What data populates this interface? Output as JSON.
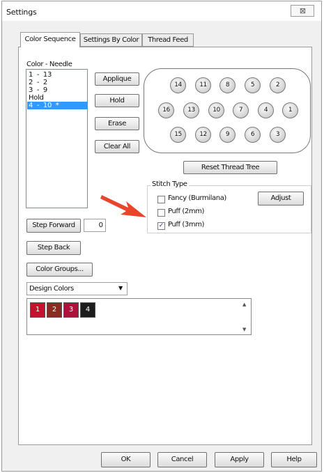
{
  "window": {
    "title": "Settings",
    "close_glyph": "⊠"
  },
  "tabs": [
    {
      "label": "Color Sequence",
      "active": true
    },
    {
      "label": "Settings By Color",
      "active": false
    },
    {
      "label": "Thread Feed",
      "active": false
    }
  ],
  "color_sequence": {
    "list_label": "Color - Needle",
    "list_items": [
      {
        "text": "1  -  13",
        "selected": false
      },
      {
        "text": "2  -  2",
        "selected": false
      },
      {
        "text": "3  -  9",
        "selected": false
      },
      {
        "text": "Hold",
        "selected": false
      },
      {
        "text": "4  -  10  *",
        "selected": true
      }
    ],
    "buttons": {
      "applique": "Applique",
      "hold": "Hold",
      "erase": "Erase",
      "clear_all": "Clear All"
    },
    "needles_row1": [
      "14",
      "11",
      "8",
      "5",
      "2"
    ],
    "needles_row2": [
      "16",
      "13",
      "10",
      "7",
      "4",
      "1"
    ],
    "needles_row3": [
      "15",
      "12",
      "9",
      "6",
      "3"
    ],
    "reset_thread_tree": "Reset Thread Tree",
    "stitch_type": {
      "title": "Stitch  Type",
      "options": [
        {
          "label": "Fancy (Burmilana)",
          "checked": false
        },
        {
          "label": "Puff (2mm)",
          "checked": false
        },
        {
          "label": "Puff (3mm)",
          "checked": true
        }
      ],
      "adjust": "Adjust",
      "check_glyph": "✓"
    },
    "step_forward": "Step Forward",
    "step_value": "0",
    "step_back": "Step Back",
    "color_groups": "Color Groups...",
    "dropdown": {
      "selected": "Design Colors",
      "arrow_glyph": "▼"
    },
    "swatches": [
      {
        "label": "1",
        "color": "#c8102e"
      },
      {
        "label": "2",
        "color": "#8b2a1e"
      },
      {
        "label": "3",
        "color": "#b0103a"
      },
      {
        "label": "4",
        "color": "#1c1c1c"
      }
    ],
    "scroll_up_glyph": "▲",
    "scroll_down_glyph": "▼",
    "arrow_color": "#e8452c"
  },
  "footer": {
    "ok": "OK",
    "cancel": "Cancel",
    "apply": "Apply",
    "help": "Help"
  }
}
